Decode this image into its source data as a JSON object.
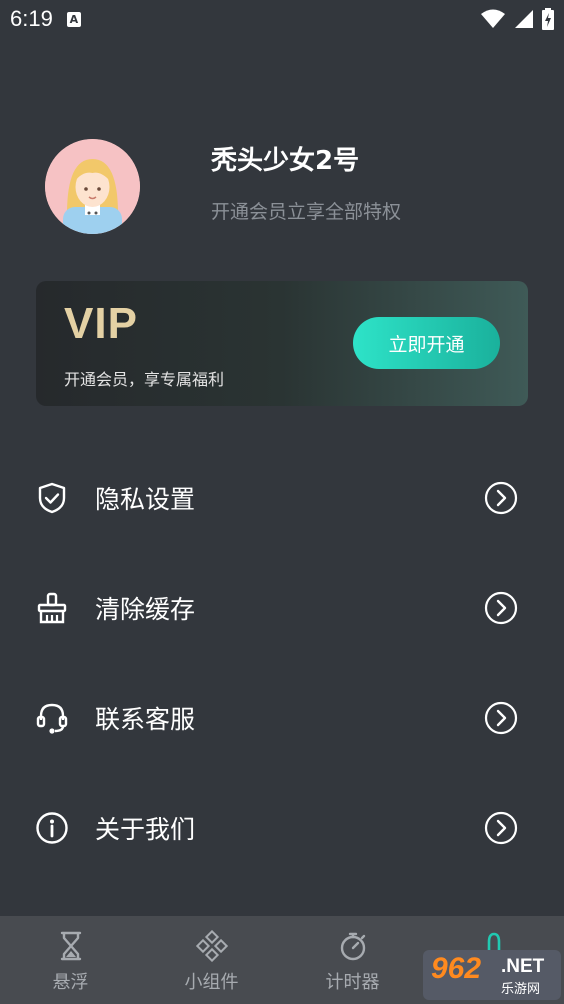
{
  "status": {
    "time": "6:19",
    "notification_letter": "A"
  },
  "profile": {
    "name": "秃头少女2号",
    "subtitle": "开通会员立享全部特权"
  },
  "vip": {
    "title": "VIP",
    "description": "开通会员，享专属福利",
    "button_label": "立即开通"
  },
  "menu": [
    {
      "label": "隐私设置",
      "icon": "shield-icon"
    },
    {
      "label": "清除缓存",
      "icon": "brush-icon"
    },
    {
      "label": "联系客服",
      "icon": "headset-icon"
    },
    {
      "label": "关于我们",
      "icon": "info-icon"
    }
  ],
  "tabs": [
    {
      "label": "悬浮",
      "icon": "hourglass-icon"
    },
    {
      "label": "小组件",
      "icon": "widgets-icon"
    },
    {
      "label": "计时器",
      "icon": "stopwatch-icon"
    },
    {
      "label": "",
      "icon": "profile-icon"
    }
  ],
  "watermark": {
    "number": "962",
    "domain": ".NET",
    "chinese": "乐游网"
  },
  "colors": {
    "background": "#33373d",
    "accent": "#21c9b1",
    "vip_gold": "#e4d1a4",
    "tabbar": "#484b50"
  }
}
